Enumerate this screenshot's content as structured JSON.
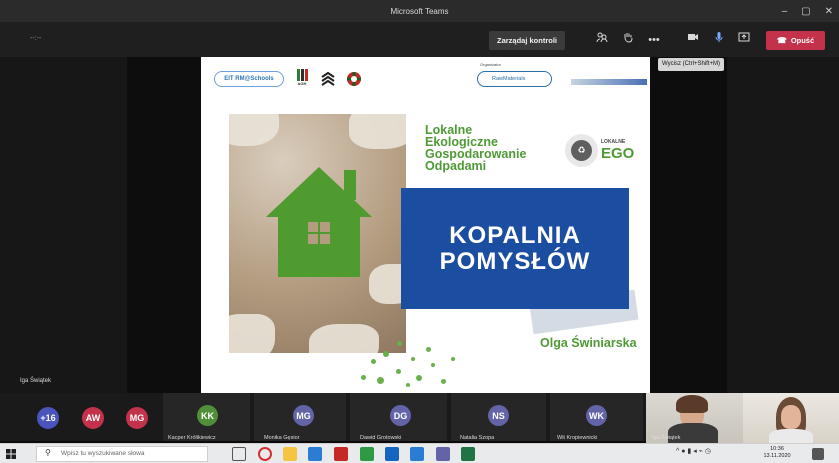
{
  "window": {
    "title": "Microsoft Teams",
    "controls": [
      "–",
      "▢",
      "✕"
    ]
  },
  "toolbar": {
    "timer": "--:--",
    "control_label": "Zarządaj kontroli",
    "leave_label": "Opuść",
    "tooltip": "Wycisz (Ctrl+Shift+M)"
  },
  "slide": {
    "org_caption": "Organizator",
    "org_logo": "RawMaterials",
    "title_lines": [
      "Lokalne",
      "Ekologiczne",
      "Gospodarowanie",
      "Odpadami"
    ],
    "ego_small": "LOKALNE",
    "ego_big": "EGO",
    "box_lines": [
      "KOPALNIA",
      "POMYSŁÓW"
    ],
    "author": "Olga Świniarska",
    "logo_pill": "EIT RM@Schools",
    "logo_agh": "AGH"
  },
  "stage": {
    "speaker_name": "Iga Świątek"
  },
  "participants": {
    "overflow": "+16",
    "avatars": [
      {
        "initials": "AW",
        "color": "#c4314b"
      },
      {
        "initials": "MG",
        "color": "#c4314b"
      },
      {
        "initials": "KK",
        "color": "#4f8f3a",
        "name": "Kacper Królikiewicz"
      },
      {
        "initials": "MG",
        "color": "#6264a7",
        "name": "Monika Gęsior"
      },
      {
        "initials": "DG",
        "color": "#6264a7",
        "name": "Dawid Grotowski"
      },
      {
        "initials": "NS",
        "color": "#6264a7",
        "name": "Natalia Szopa"
      },
      {
        "initials": "WK",
        "color": "#6264a7",
        "name": "Wit Kropiewnicki"
      }
    ],
    "video_name": "Iga Świątek"
  },
  "taskbar": {
    "search_placeholder": "Wpisz tu wyszukiwane słowa",
    "time": "10:36",
    "date": "13.11.2020"
  }
}
